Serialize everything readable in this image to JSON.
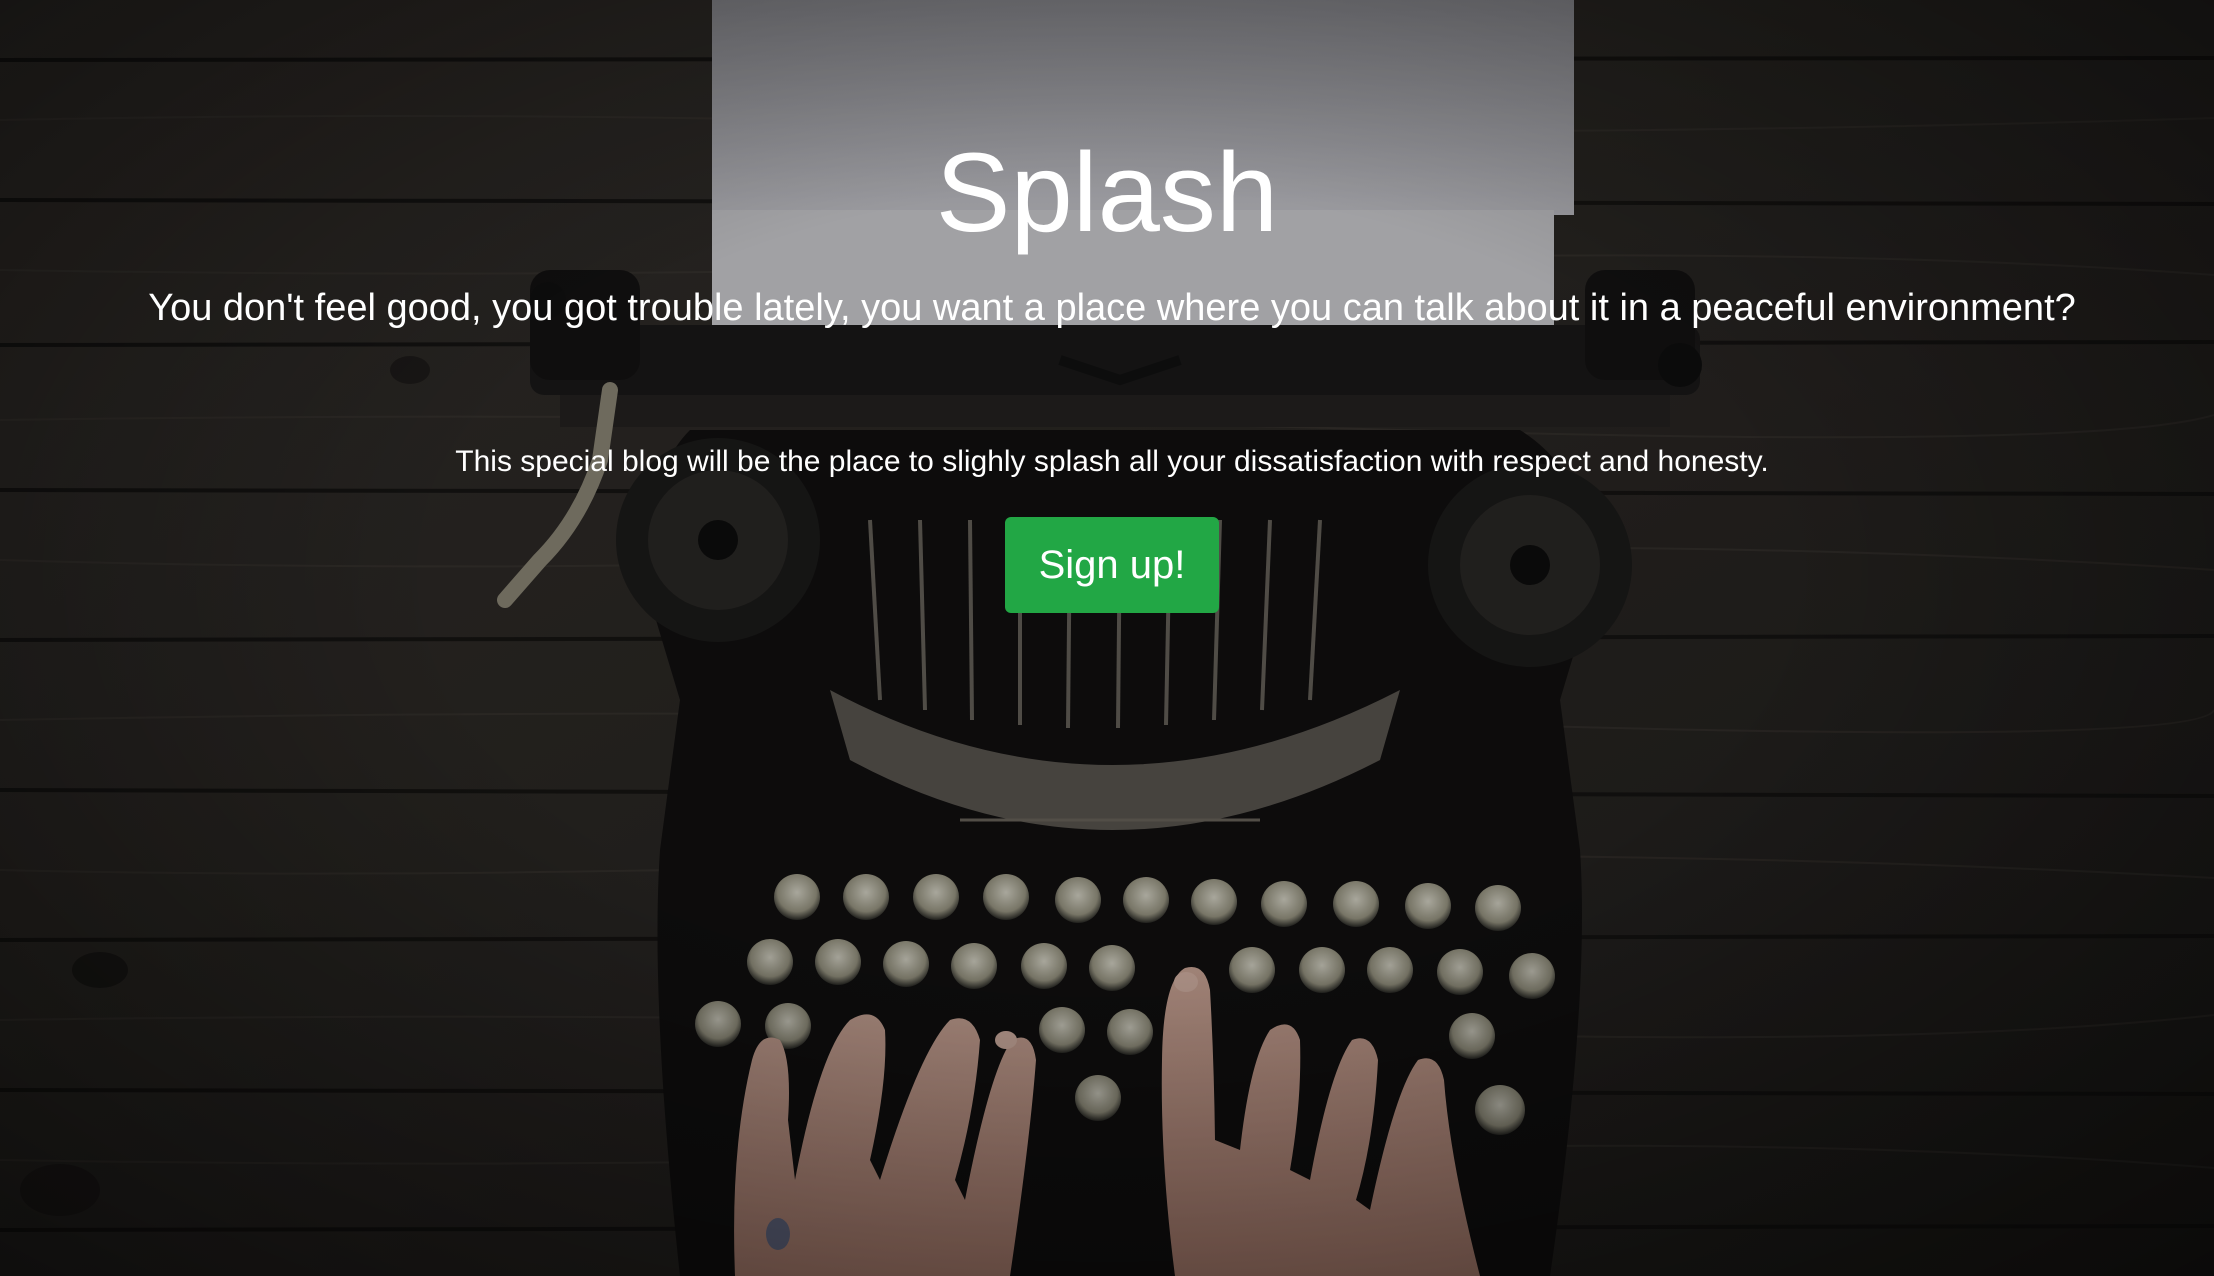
{
  "hero": {
    "title": "Splash",
    "lead": "You don't feel good, you got trouble lately, you want a place where you can talk about it in a peaceful environment?",
    "sub": "This special blog will be the place to slighly splash all your dissatisfaction with respect and honesty.",
    "signup_label": "Sign up!"
  },
  "background": {
    "icon": "typewriter-on-wood-photo",
    "wood_color": "#2a2827",
    "button_color": "#22a745"
  }
}
